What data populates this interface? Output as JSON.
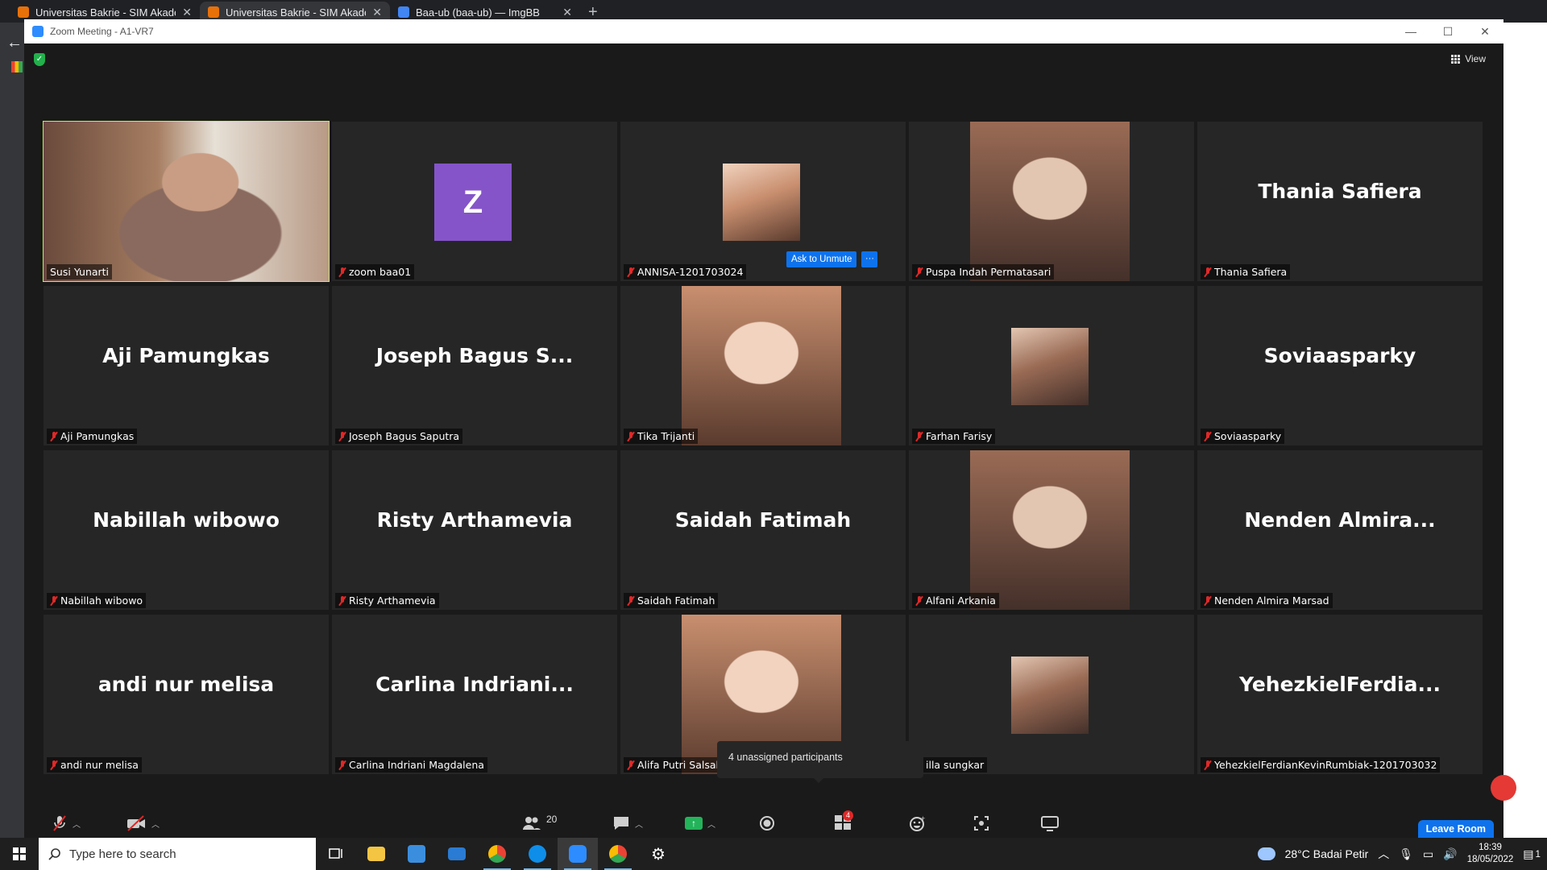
{
  "browser": {
    "tabs": [
      {
        "title": "Universitas Bakrie - SIM Akadem"
      },
      {
        "title": "Universitas Bakrie - SIM Akadem"
      },
      {
        "title": "Baa-ub (baa-ub) — ImgBB"
      }
    ]
  },
  "zoom": {
    "window_title": "Zoom Meeting - A1-VR7",
    "view_label": "View",
    "ask_to_unmute": "Ask to Unmute",
    "more_label": "···",
    "tooltip": "4 unassigned participants",
    "participants_count": "20",
    "breakout_badge": "4",
    "leave_label": "Leave Room",
    "tiles": [
      {
        "label": "Susi Yunarti",
        "avatar": "",
        "kind": "video"
      },
      {
        "label": "zoom baa01",
        "avatar": "Z",
        "kind": "letter"
      },
      {
        "label": "ANNISA-1201703024",
        "avatar": "",
        "kind": "photo"
      },
      {
        "label": "Puspa Indah Permatasari",
        "avatar": "",
        "kind": "tall"
      },
      {
        "label": "Thania Safiera",
        "avatar": "Thania Safiera",
        "kind": "name"
      },
      {
        "label": "Aji Pamungkas",
        "avatar": "Aji Pamungkas",
        "kind": "name"
      },
      {
        "label": "Joseph Bagus Saputra",
        "avatar": "Joseph Bagus S...",
        "kind": "name"
      },
      {
        "label": "Tika Trijanti",
        "avatar": "",
        "kind": "tall"
      },
      {
        "label": "Farhan Farisy",
        "avatar": "",
        "kind": "photo"
      },
      {
        "label": "Soviaasparky",
        "avatar": "Soviaasparky",
        "kind": "name"
      },
      {
        "label": "Nabillah wibowo",
        "avatar": "Nabillah wibowo",
        "kind": "name"
      },
      {
        "label": "Risty Arthamevia",
        "avatar": "Risty Arthamevia",
        "kind": "name"
      },
      {
        "label": "Saidah Fatimah",
        "avatar": "Saidah Fatimah",
        "kind": "name"
      },
      {
        "label": "Alfani Arkania",
        "avatar": "",
        "kind": "tall"
      },
      {
        "label": "Nenden Almira Marsad",
        "avatar": "Nenden Almira...",
        "kind": "name"
      },
      {
        "label": "andi nur melisa",
        "avatar": "andi nur melisa",
        "kind": "name"
      },
      {
        "label": "Carlina Indriani Magdalena",
        "avatar": "Carlina Indriani...",
        "kind": "name"
      },
      {
        "label": "Alifa Putri Salsabila",
        "avatar": "",
        "kind": "tall"
      },
      {
        "label": "illa sungkar",
        "avatar": "",
        "kind": "photo"
      },
      {
        "label": "YehezkielFerdianKevinRumbiak-1201703032",
        "avatar": "YehezkielFerdia...",
        "kind": "name"
      }
    ]
  },
  "taskbar": {
    "search_placeholder": "Type here to search",
    "weather": "28°C  Badai Petir",
    "time": "18:39",
    "date": "18/05/2022",
    "notifications": "1"
  }
}
